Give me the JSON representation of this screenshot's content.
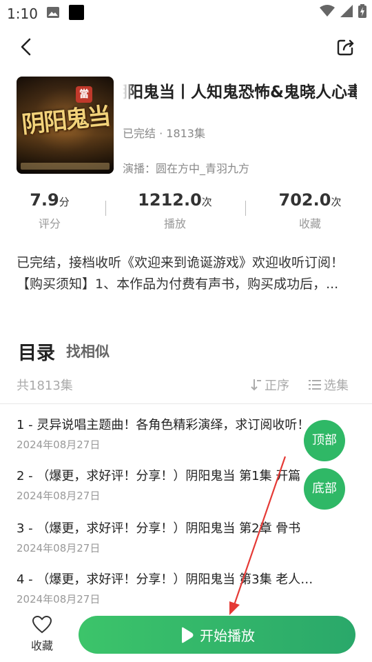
{
  "status_bar": {
    "time": "1:10",
    "icons": [
      "image-icon",
      "black-square-icon",
      "wifi-icon",
      "signal-icon",
      "battery-icon"
    ]
  },
  "header": {
    "back_icon": "chevron-left-icon",
    "share_icon": "share-icon"
  },
  "book": {
    "cover_title": "阴阳鬼当",
    "cover_badge": "當",
    "title": "阴阳鬼当丨人知鬼恐怖&鬼晓人心毒丨",
    "status": "已完结 · 1813集",
    "narrator": "演播：圆在方中_青羽九方"
  },
  "stats": [
    {
      "value": "7.9",
      "unit": "分",
      "label": "评分"
    },
    {
      "value": "1212.0",
      "unit": "次",
      "label": "播放"
    },
    {
      "value": "702.0",
      "unit": "次",
      "label": "收藏"
    }
  ],
  "description": "已完结，接档收听《欢迎来到诡诞游戏》欢迎收听订阅！【购买须知】1、本作品为付费有声书，购买成功后，...",
  "catalog": {
    "title": "目录",
    "similar": "找相似",
    "count": "共1813集",
    "sort_label": "正序",
    "select_label": "选集"
  },
  "episodes": [
    {
      "title": "1 - 灵异说唱主题曲！各角色精彩演绎，求订阅收听！",
      "date": "2024年08月27日"
    },
    {
      "title": "2 - （爆更，求好评！分享！）阴阳鬼当 第1集 开篇",
      "date": "2024年08月27日"
    },
    {
      "title": "3 - （爆更，求好评！分享！）阴阳鬼当 第2章 骨书",
      "date": "2024年08月27日"
    },
    {
      "title": "4 - （爆更，求好评！分享！）阴阳鬼当 第3集 老人…",
      "date": "2024年08月27日"
    }
  ],
  "float_buttons": {
    "top": "顶部",
    "bottom": "底部"
  },
  "bottom_bar": {
    "favorite_label": "收藏",
    "play_label": "开始播放"
  },
  "colors": {
    "accent": "#2fb866",
    "annotation_arrow": "#e53935"
  }
}
